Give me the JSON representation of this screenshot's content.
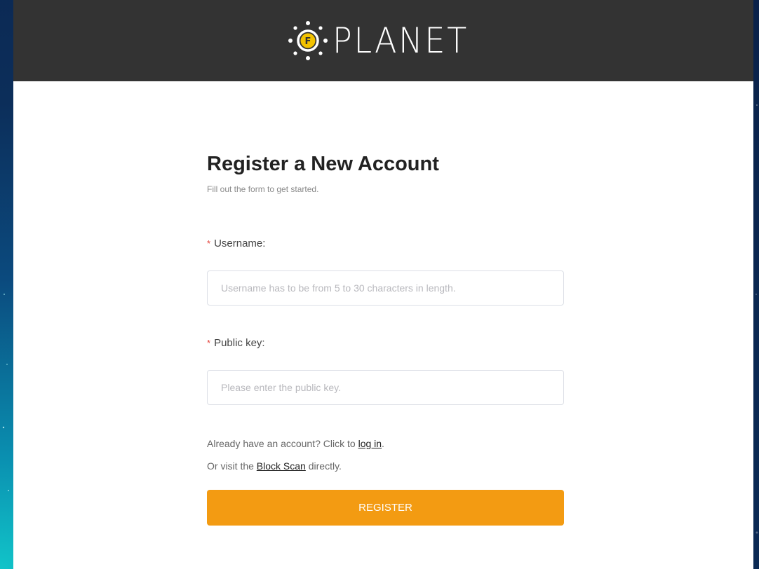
{
  "header": {
    "brand": "PLANET",
    "logo_icon": "sun-coin-icon"
  },
  "form": {
    "title": "Register a New Account",
    "subtitle": "Fill out the form to get started.",
    "required_marker": "*",
    "username": {
      "label": "Username:",
      "value": "",
      "placeholder": "Username has to be from 5 to 30 characters in length."
    },
    "public_key": {
      "label": "Public key:",
      "value": "",
      "placeholder": "Please enter the public key."
    },
    "login_hint": {
      "prefix": "Already have an account? Click to ",
      "link": "log in",
      "suffix": "."
    },
    "scan_hint": {
      "prefix": "Or visit the ",
      "link": "Block Scan",
      "suffix": " directly."
    },
    "submit_label": "REGISTER"
  },
  "colors": {
    "header_bg": "#333333",
    "accent": "#f39b12",
    "required": "#e4433c",
    "logo_coin": "#f2c200"
  }
}
